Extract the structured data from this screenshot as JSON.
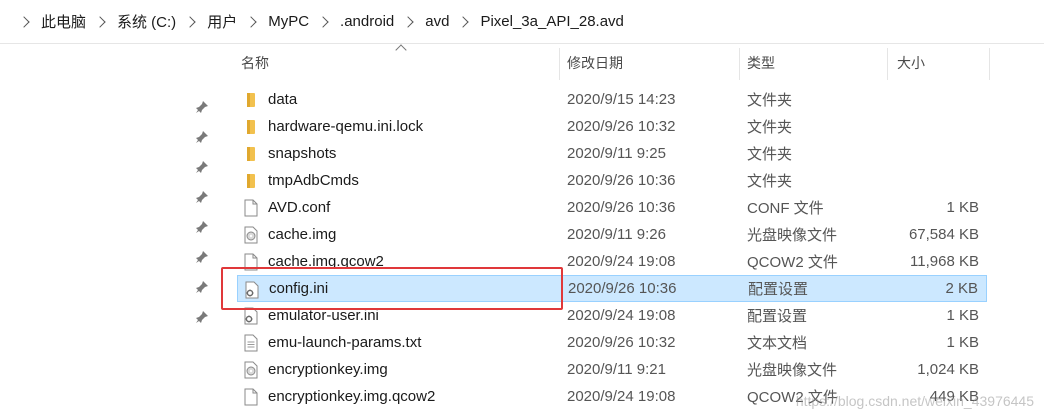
{
  "breadcrumbs": [
    "此电脑",
    "系统 (C:)",
    "用户",
    "MyPC",
    ".android",
    "avd",
    "Pixel_3a_API_28.avd"
  ],
  "columns": {
    "name": "名称",
    "date": "修改日期",
    "type": "类型",
    "size": "大小"
  },
  "files": [
    {
      "name": "data",
      "date": "2020/9/15 14:23",
      "type": "文件夹",
      "size": "",
      "icon": "folder-icon"
    },
    {
      "name": "hardware-qemu.ini.lock",
      "date": "2020/9/26 10:32",
      "type": "文件夹",
      "size": "",
      "icon": "folder-icon"
    },
    {
      "name": "snapshots",
      "date": "2020/9/11 9:25",
      "type": "文件夹",
      "size": "",
      "icon": "folder-icon"
    },
    {
      "name": "tmpAdbCmds",
      "date": "2020/9/26 10:36",
      "type": "文件夹",
      "size": "",
      "icon": "folder-icon"
    },
    {
      "name": "AVD.conf",
      "date": "2020/9/26 10:36",
      "type": "CONF 文件",
      "size": "1 KB",
      "icon": "file-icon"
    },
    {
      "name": "cache.img",
      "date": "2020/9/11 9:26",
      "type": "光盘映像文件",
      "size": "67,584 KB",
      "icon": "disc-image-icon"
    },
    {
      "name": "cache.img.qcow2",
      "date": "2020/9/24 19:08",
      "type": "QCOW2 文件",
      "size": "11,968 KB",
      "icon": "file-icon"
    },
    {
      "name": "config.ini",
      "date": "2020/9/26 10:36",
      "type": "配置设置",
      "size": "2 KB",
      "icon": "config-file-icon"
    },
    {
      "name": "emulator-user.ini",
      "date": "2020/9/24 19:08",
      "type": "配置设置",
      "size": "1 KB",
      "icon": "config-file-icon"
    },
    {
      "name": "emu-launch-params.txt",
      "date": "2020/9/26 10:32",
      "type": "文本文档",
      "size": "1 KB",
      "icon": "text-file-icon"
    },
    {
      "name": "encryptionkey.img",
      "date": "2020/9/11 9:21",
      "type": "光盘映像文件",
      "size": "1,024 KB",
      "icon": "disc-image-icon"
    },
    {
      "name": "encryptionkey.img.qcow2",
      "date": "2020/9/24 19:08",
      "type": "QCOW2 文件",
      "size": "449 KB",
      "icon": "file-icon"
    }
  ],
  "selected_index": 7,
  "watermark": "https://blog.csdn.net/weixin_43976445",
  "colors": {
    "selection_bg": "#cce8ff",
    "selection_border": "#99d1ff",
    "highlight_box": "#e0383a",
    "folder": "#f2c14e"
  }
}
